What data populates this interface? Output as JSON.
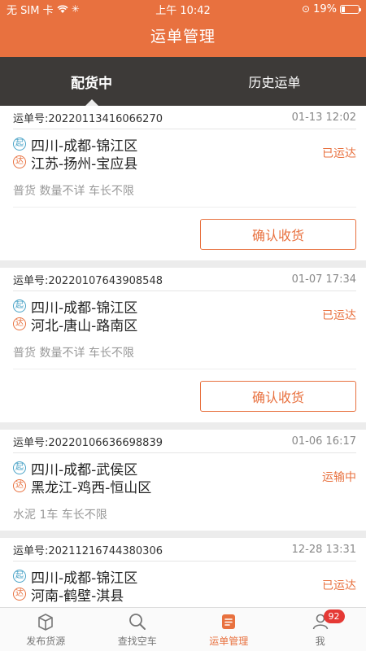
{
  "status_bar": {
    "carrier": "无 SIM 卡",
    "time": "上午 10:42",
    "battery": "19%"
  },
  "header": {
    "title": "运单管理"
  },
  "tabs": [
    {
      "label": "配货中",
      "active": true
    },
    {
      "label": "历史运单",
      "active": false
    }
  ],
  "orders": [
    {
      "no": "运单号:20220113416066270",
      "time": "01-13 12:02",
      "from": "四川-成都-锦江区",
      "to": "江苏-扬州-宝应县",
      "status": "已运达",
      "desc": "普货 数量不详 车长不限",
      "action": "确认收货"
    },
    {
      "no": "运单号:20220107643908548",
      "time": "01-07 17:34",
      "from": "四川-成都-锦江区",
      "to": "河北-唐山-路南区",
      "status": "已运达",
      "desc": "普货 数量不详 车长不限",
      "action": "确认收货"
    },
    {
      "no": "运单号:20220106636698839",
      "time": "01-06 16:17",
      "from": "四川-成都-武侯区",
      "to": "黑龙江-鸡西-恒山区",
      "status": "运输中",
      "desc": "水泥 1车 车长不限"
    },
    {
      "no": "运单号:20211216744380306",
      "time": "12-28 13:31",
      "from": "四川-成都-锦江区",
      "to": "河南-鹤壁-淇县",
      "status": "已运达",
      "desc": ""
    }
  ],
  "badges": {
    "from": "起",
    "to": "达"
  },
  "tabbar": [
    {
      "label": "发布货源",
      "icon": "box-icon"
    },
    {
      "label": "查找空车",
      "icon": "search-icon"
    },
    {
      "label": "运单管理",
      "icon": "document-icon",
      "active": true
    },
    {
      "label": "我",
      "icon": "user-icon",
      "badge": "92"
    }
  ],
  "colors": {
    "accent": "#e8713f",
    "tab_bg": "#3d3a38",
    "origin": "#4aa3c7"
  }
}
